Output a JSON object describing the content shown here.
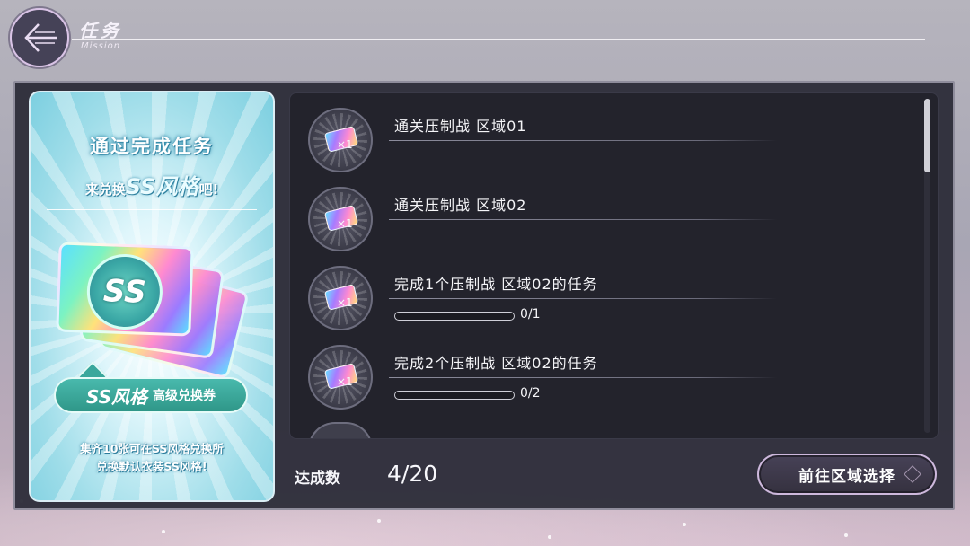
{
  "header": {
    "title": "任务",
    "subtitle": "Mission",
    "back_icon": "back-arrow-icon"
  },
  "promo": {
    "headline": "通过完成任务",
    "line2_prefix": "来兑换",
    "line2_emphasis": "SS风格",
    "line2_suffix": "吧!",
    "ticket_medal_text": "SS",
    "item_name_main": "SS风格",
    "item_name_sub": "高级兑换券",
    "description_line1": "集齐10张可在SS风格兑换所",
    "description_line2": "兑换默认衣装SS风格!"
  },
  "missions": [
    {
      "title": "通关压制战  区域01",
      "reward_count": "×1",
      "progress": null,
      "progress_fraction": null
    },
    {
      "title": "通关压制战  区域02",
      "reward_count": "×1",
      "progress": null,
      "progress_fraction": null
    },
    {
      "title": "完成1个压制战  区域02的任务",
      "reward_count": "×1",
      "progress": "0/1",
      "progress_fraction": 0
    },
    {
      "title": "完成2个压制战  区域02的任务",
      "reward_count": "×1",
      "progress": "0/2",
      "progress_fraction": 0
    }
  ],
  "footer": {
    "achievement_label": "达成数",
    "achievement_value": "4/20",
    "action_button": "前往区域选择"
  },
  "colors": {
    "panel_bg": "#2e2e3a",
    "list_bg": "#23232c",
    "accent_border": "#cdb8dc",
    "promo_teal": "#3aa79c"
  }
}
